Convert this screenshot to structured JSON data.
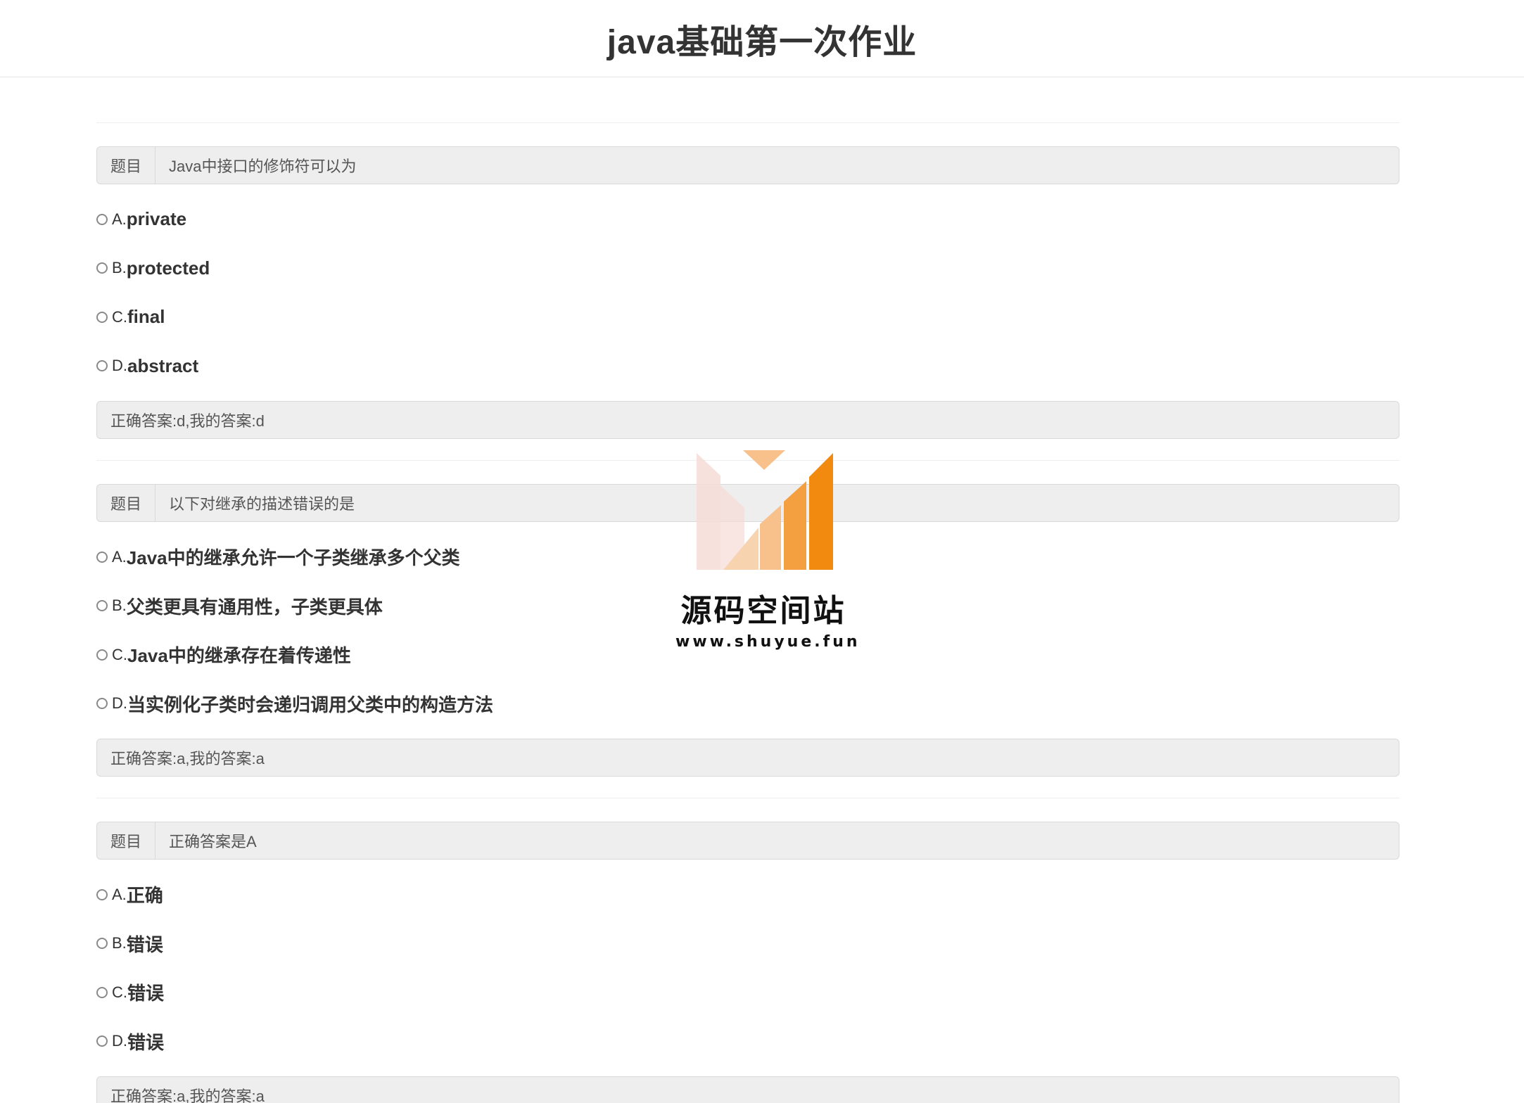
{
  "page": {
    "title": "java基础第一次作业"
  },
  "questions": [
    {
      "label": "题目",
      "text": "Java中接口的修饰符可以为",
      "options": [
        {
          "letter": "A.",
          "text": "private"
        },
        {
          "letter": "B.",
          "text": "protected"
        },
        {
          "letter": "C.",
          "text": "final"
        },
        {
          "letter": "D.",
          "text": "abstract"
        }
      ],
      "answer": "正确答案:d,我的答案:d"
    },
    {
      "label": "题目",
      "text": "以下对继承的描述错误的是",
      "options": [
        {
          "letter": "A.",
          "text": "Java中的继承允许一个子类继承多个父类"
        },
        {
          "letter": "B.",
          "text": "父类更具有通用性，子类更具体"
        },
        {
          "letter": "C.",
          "text": "Java中的继承存在着传递性"
        },
        {
          "letter": "D.",
          "text": "当实例化子类时会递归调用父类中的构造方法"
        }
      ],
      "answer": "正确答案:a,我的答案:a"
    },
    {
      "label": "题目",
      "text": "正确答案是A",
      "options": [
        {
          "letter": "A.",
          "text": "正确"
        },
        {
          "letter": "B.",
          "text": "错误"
        },
        {
          "letter": "C.",
          "text": "错误"
        },
        {
          "letter": "D.",
          "text": "错误"
        }
      ],
      "answer": "正确答案:a,我的答案:a"
    }
  ],
  "watermark": {
    "title": "源码空间站",
    "url": "www.shuyue.fun",
    "colors": {
      "pale": "#f6dcd6",
      "light_orange": "#f8c08a",
      "orange": "#f5a040",
      "dark_orange": "#f28a10"
    }
  }
}
